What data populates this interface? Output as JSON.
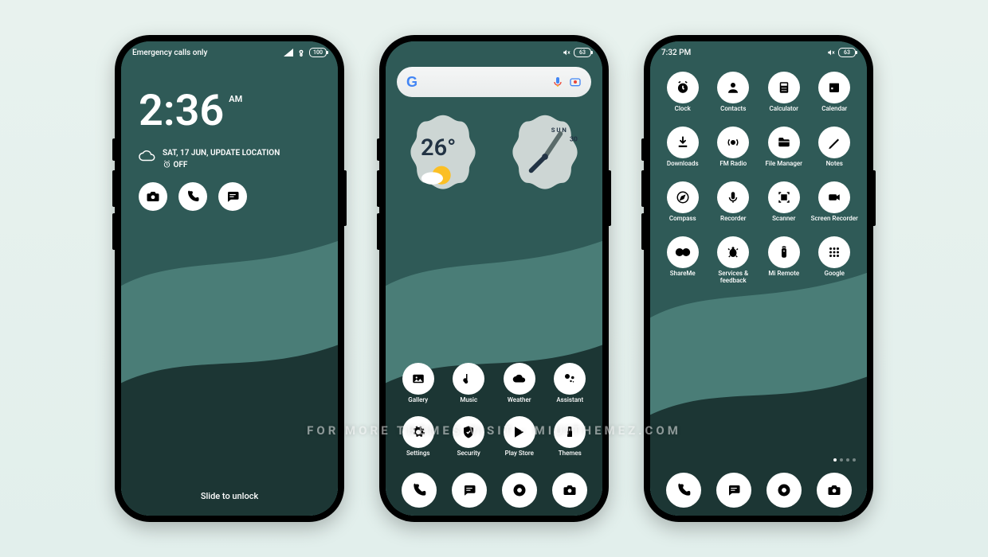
{
  "watermark": "FOR MORE THEMES VISIT - MIUITHEMEZ.COM",
  "colors": {
    "bg_top": "#2f5a57",
    "bg_mid": "#4a7d77",
    "bg_dark": "#1c3634",
    "accent_white": "#ffffff"
  },
  "lock": {
    "status_left": "Emergency calls only",
    "battery": "100",
    "time": "2:36",
    "ampm": "AM",
    "date": "SAT, 17 JUN, UPDATE LOCATION",
    "alarm": "OFF",
    "quick": [
      {
        "name": "camera-icon"
      },
      {
        "name": "phone-icon"
      },
      {
        "name": "messages-icon"
      }
    ],
    "hint": "Slide to unlock"
  },
  "home": {
    "battery": "63",
    "search_placeholder": "",
    "weather_temp": "26°",
    "clock_day": "SUN",
    "clock_date": "30",
    "row1": [
      {
        "name": "gallery-icon",
        "label": "Gallery"
      },
      {
        "name": "music-icon",
        "label": "Music"
      },
      {
        "name": "weather-icon",
        "label": "Weather"
      },
      {
        "name": "assistant-icon",
        "label": "Assistant"
      }
    ],
    "row2": [
      {
        "name": "settings-icon",
        "label": "Settings"
      },
      {
        "name": "security-icon",
        "label": "Security"
      },
      {
        "name": "playstore-icon",
        "label": "Play Store"
      },
      {
        "name": "themes-icon",
        "label": "Themes"
      }
    ],
    "dock": [
      {
        "name": "dialer-icon"
      },
      {
        "name": "messages-icon"
      },
      {
        "name": "chrome-icon"
      },
      {
        "name": "camera-icon"
      }
    ]
  },
  "drawer": {
    "status_left": "7:32 PM",
    "battery": "63",
    "rows": [
      [
        {
          "name": "clock-icon",
          "label": "Clock"
        },
        {
          "name": "contacts-icon",
          "label": "Contacts"
        },
        {
          "name": "calculator-icon",
          "label": "Calculator"
        },
        {
          "name": "calendar-icon",
          "label": "Calendar"
        }
      ],
      [
        {
          "name": "downloads-icon",
          "label": "Downloads"
        },
        {
          "name": "fmradio-icon",
          "label": "FM Radio"
        },
        {
          "name": "filemanager-icon",
          "label": "File Manager"
        },
        {
          "name": "notes-icon",
          "label": "Notes"
        }
      ],
      [
        {
          "name": "compass-icon",
          "label": "Compass"
        },
        {
          "name": "recorder-icon",
          "label": "Recorder"
        },
        {
          "name": "scanner-icon",
          "label": "Scanner"
        },
        {
          "name": "screenrecorder-icon",
          "label": "Screen Recorder"
        }
      ],
      [
        {
          "name": "shareme-icon",
          "label": "ShareMe"
        },
        {
          "name": "services-icon",
          "label": "Services & feedback"
        },
        {
          "name": "miremote-icon",
          "label": "Mi Remote"
        },
        {
          "name": "google-icon",
          "label": "Google"
        }
      ]
    ],
    "dock": [
      {
        "name": "dialer-icon"
      },
      {
        "name": "messages-icon"
      },
      {
        "name": "chrome-icon"
      },
      {
        "name": "camera-icon"
      }
    ]
  }
}
